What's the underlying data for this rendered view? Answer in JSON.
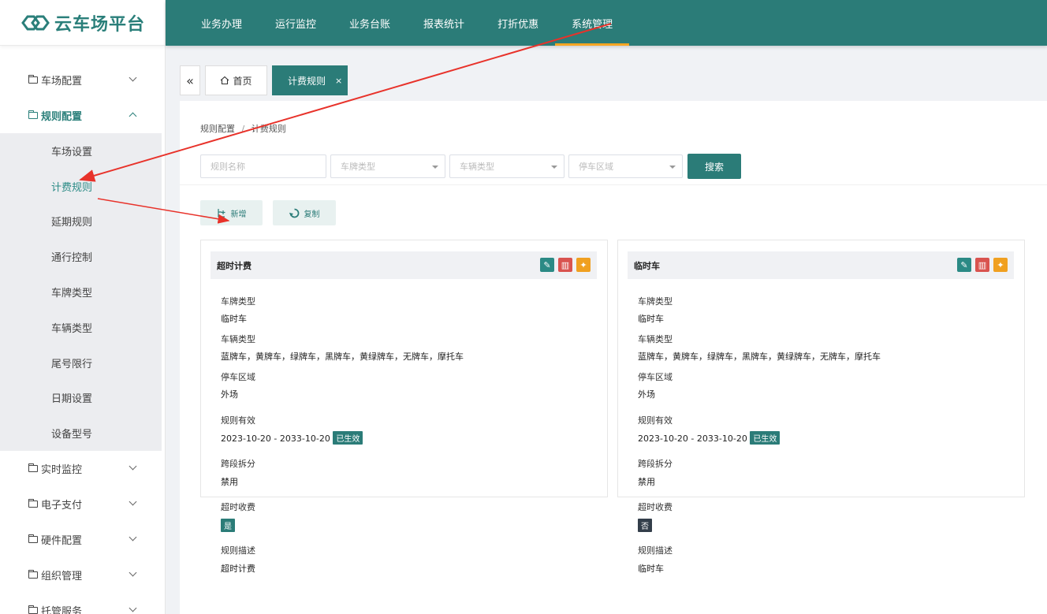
{
  "app": {
    "logo_text": "云车场平台"
  },
  "topnav": [
    {
      "label": "业务办理",
      "active": false
    },
    {
      "label": "运行监控",
      "active": false
    },
    {
      "label": "业务台账",
      "active": false
    },
    {
      "label": "报表统计",
      "active": false
    },
    {
      "label": "打折优惠",
      "active": false
    },
    {
      "label": "系统管理",
      "active": true
    }
  ],
  "sidebar": {
    "groups_before": [
      {
        "label": "车场配置",
        "expanded": false
      }
    ],
    "active_group": {
      "label": "规则配置",
      "expanded": true
    },
    "sub_items": [
      {
        "label": "车场设置",
        "active": false
      },
      {
        "label": "计费规则",
        "active": true
      },
      {
        "label": "延期规则",
        "active": false
      },
      {
        "label": "通行控制",
        "active": false
      },
      {
        "label": "车牌类型",
        "active": false
      },
      {
        "label": "车辆类型",
        "active": false
      },
      {
        "label": "尾号限行",
        "active": false
      },
      {
        "label": "日期设置",
        "active": false
      },
      {
        "label": "设备型号",
        "active": false
      }
    ],
    "groups_after": [
      {
        "label": "实时监控"
      },
      {
        "label": "电子支付"
      },
      {
        "label": "硬件配置"
      },
      {
        "label": "组织管理"
      },
      {
        "label": "托管服务"
      }
    ]
  },
  "tabs": {
    "home_label": "首页",
    "current_label": "计费规则",
    "close_glyph": "×",
    "collapse_glyph": "«"
  },
  "breadcrumb": {
    "parent": "规则配置",
    "separator": "/",
    "current": "计费规则"
  },
  "filters": {
    "rule_name_placeholder": "规则名称",
    "plate_type_placeholder": "车牌类型",
    "vehicle_type_placeholder": "车辆类型",
    "parking_area_placeholder": "停车区域",
    "search_label": "搜索"
  },
  "actions": {
    "add_label": "新增",
    "copy_label": "复制"
  },
  "cards": [
    {
      "title": "超时计费",
      "plate_type_label": "车牌类型",
      "plate_type": "临时车",
      "vehicle_type_label": "车辆类型",
      "vehicle_type": "蓝牌车，黄牌车，绿牌车，黑牌车，黄绿牌车，无牌车，摩托车",
      "area_label": "停车区域",
      "area": "外场",
      "valid_label": "规则有效",
      "valid_range": "2023-10-20 - 2033-10-20",
      "valid_status": "已生效",
      "split_label": "跨段拆分",
      "split": "禁用",
      "overtime_label": "超时收费",
      "overtime": "是",
      "desc_label": "规则描述",
      "desc": "超时计费"
    },
    {
      "title": "临时车",
      "plate_type_label": "车牌类型",
      "plate_type": "临时车",
      "vehicle_type_label": "车辆类型",
      "vehicle_type": "蓝牌车，黄牌车，绿牌车，黑牌车，黄绿牌车，无牌车，摩托车",
      "area_label": "停车区域",
      "area": "外场",
      "valid_label": "规则有效",
      "valid_range": "2023-10-20 - 2033-10-20",
      "valid_status": "已生效",
      "split_label": "跨段拆分",
      "split": "禁用",
      "overtime_label": "超时收费",
      "overtime": "否",
      "desc_label": "规则描述",
      "desc": "临时车"
    }
  ],
  "colors": {
    "primary": "#2b7c78",
    "accent": "#f5a623",
    "danger": "#d9534f",
    "annotation_arrow": "#e8322a"
  }
}
